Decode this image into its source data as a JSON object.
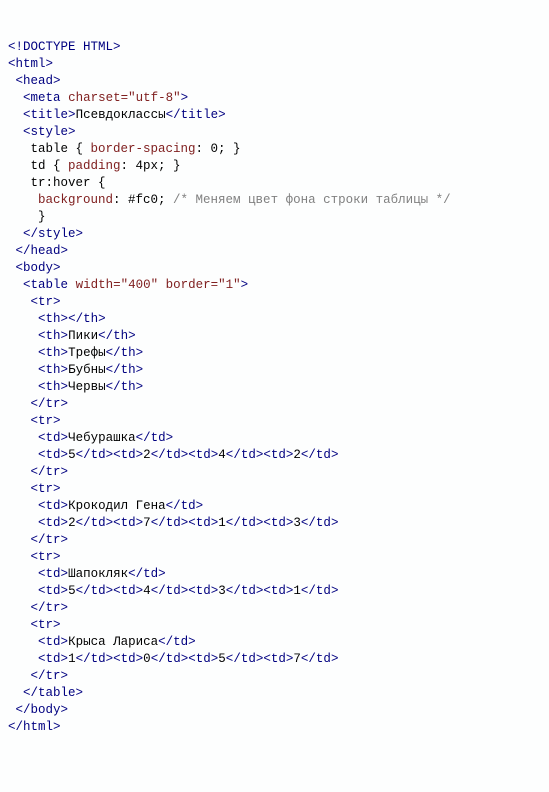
{
  "doctype": "DOCTYPE HTML",
  "tags": {
    "html_o": "html",
    "html_c": "/html",
    "head_o": "head",
    "head_c": "/head",
    "meta": "meta",
    "meta_charset_attr": "charset",
    "meta_charset_val": "\"utf-8\"",
    "title_o": "title",
    "title_c": "/title",
    "title_text": "Псевдоклассы",
    "style_o": "style",
    "style_c": "/style",
    "body_o": "body",
    "body_c": "/body",
    "table_o": "table",
    "table_c": "/table",
    "table_width_attr": "width",
    "table_width_val": "\"400\"",
    "table_border_attr": "border",
    "table_border_val": "\"1\"",
    "tr_o": "tr",
    "tr_c": "/tr",
    "th_o": "th",
    "th_c": "/th",
    "td_o": "td",
    "td_c": "/td"
  },
  "css": {
    "table_rule": "   table { ",
    "table_prop": "border-spacing",
    "table_rest": ": 0; }",
    "td_rule": "   td { ",
    "td_prop": "padding",
    "td_rest": ": 4px; }",
    "trhover_rule": "   tr:hover {",
    "bg_indent": "    ",
    "bg_prop": "background",
    "bg_rest": ": #fc0; ",
    "comment": "/* Меняем цвет фона строки таблицы */",
    "close_brace": "    }"
  },
  "headers": {
    "h1": "Пики",
    "h2": "Трефы",
    "h3": "Бубны",
    "h4": "Червы"
  },
  "row1": {
    "name": "Чебурашка",
    "c1": "5",
    "c2": "2",
    "c3": "4",
    "c4": "2"
  },
  "row2": {
    "name": "Крокодил Гена",
    "c1": "2",
    "c2": "7",
    "c3": "1",
    "c4": "3"
  },
  "row3": {
    "name": "Шапокляк",
    "c1": "5",
    "c2": "4",
    "c3": "3",
    "c4": "1"
  },
  "row4": {
    "name": "Крыса Лариса",
    "c1": "1",
    "c2": "0",
    "c3": "5",
    "c4": "7"
  },
  "chart_data": {
    "type": "table",
    "title": "Псевдоклассы",
    "columns": [
      "",
      "Пики",
      "Трефы",
      "Бубны",
      "Червы"
    ],
    "rows": [
      [
        "Чебурашка",
        5,
        2,
        4,
        2
      ],
      [
        "Крокодил Гена",
        2,
        7,
        1,
        3
      ],
      [
        "Шапокляк",
        5,
        4,
        3,
        1
      ],
      [
        "Крыса Лариса",
        1,
        0,
        5,
        7
      ]
    ]
  }
}
